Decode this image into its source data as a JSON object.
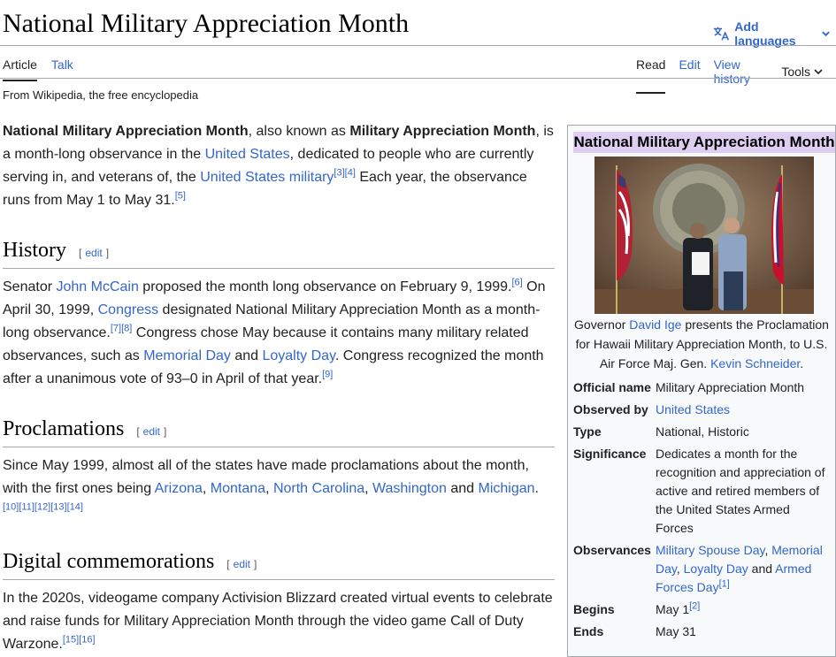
{
  "page": {
    "title": "National Military Appreciation Month",
    "add_languages": "Add languages",
    "tagline": "From Wikipedia, the free encyclopedia"
  },
  "tabs_left": [
    "Article",
    "Talk"
  ],
  "tabs_right": [
    "Read",
    "Edit",
    "View history",
    "Tools"
  ],
  "intro": {
    "b1": "National Military Appreciation Month",
    "t1": ", also known as ",
    "b2": "Military Appreciation Month",
    "t2": ", is a month-long observance in the ",
    "l1": "United States",
    "t3": ", dedicated to people who are currently serving in, and veterans of, the ",
    "l2": "United States military",
    "r1": "[3]",
    "r2": "[4]",
    "t4": " Each year, the observance runs from May 1 to May 31.",
    "r3": "[5]"
  },
  "history": {
    "heading": "History",
    "t1": "Senator ",
    "l1": "John McCain",
    "t2": " proposed the month long observance on February 9, 1999.",
    "r1": "[6]",
    "t3": " On April 30, 1999, ",
    "l2": "Congress",
    "t4": " designated National Military Appreciation Month as a month-long observance.",
    "r2": "[7]",
    "r3": "[8]",
    "t5": " Congress chose May because it contains many military related observances, such as ",
    "l3": "Memorial Day",
    "t6": " and ",
    "l4": "Loyalty Day",
    "t7": ". Congress recognized the month after a unanimous vote of 93–0 in April of that year.",
    "r4": "[9]"
  },
  "proclamations": {
    "heading": "Proclamations",
    "t1": "Since May 1999, almost all of the states have made proclamations about the month, with the first ones being ",
    "l1": "Arizona",
    "s1": ", ",
    "l2": "Montana",
    "s2": ", ",
    "l3": "North Carolina",
    "s3": ", ",
    "l4": "Washington",
    "t2": " and ",
    "l5": "Michigan",
    "t3": ".",
    "r1": "[10]",
    "r2": "[11]",
    "r3": "[12]",
    "r4": "[13]",
    "r5": "[14]"
  },
  "digital": {
    "heading": "Digital commemorations",
    "t1": "In the 2020s, videogame company Activision Blizzard created virtual events to celebrate and raise funds for Military Appreciation Month through the video game Call of Duty Warzone.",
    "r1": "[15]",
    "r2": "[16]"
  },
  "edit_link": {
    "open": "[",
    "label": "edit",
    "close": "]"
  },
  "infobox": {
    "title": "National Military Appreciation Month",
    "caption": {
      "t1": "Governor ",
      "l1": "David Ige",
      "t2": " presents the Proclamation for Hawaii Military Appreciation Month, to U.S. Air Force Maj. Gen. ",
      "l2": "Kevin Schneider",
      "t3": "."
    },
    "official_name_label": "Official name",
    "official_name": "Military Appreciation Month",
    "observed_by_label": "Observed by",
    "observed_by": "United States",
    "type_label": "Type",
    "type": "National, Historic",
    "significance_label": "Significance",
    "significance": "Dedicates a month for the recognition and appreciation of active and retired members of the United States Armed Forces",
    "observances_label": "Observances",
    "obs_l1": "Military Spouse Day",
    "obs_s1": ", ",
    "obs_l2": "Memorial Day",
    "obs_s2": ", ",
    "obs_l3": "Loyalty Day",
    "obs_t": " and ",
    "obs_l4": "Armed Forces Day",
    "obs_r": "[1]",
    "begins_label": "Begins",
    "begins": "May 1",
    "begins_r": "[2]",
    "ends_label": "Ends",
    "ends": "May 31"
  },
  "colors": {
    "link": "#3366cc",
    "infobox_title_bg": "#ddcef2",
    "rule": "#a2a9b1"
  }
}
